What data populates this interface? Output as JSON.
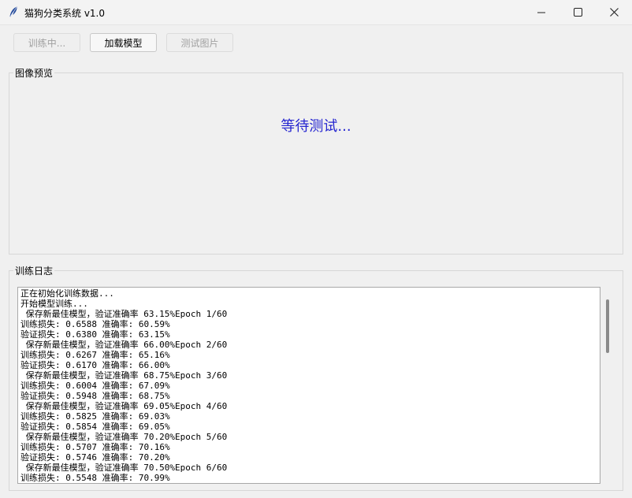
{
  "window": {
    "title": "猫狗分类系统 v1.0",
    "icons": {
      "app": "feather-icon",
      "minimize": "minimize-icon",
      "maximize": "maximize-icon",
      "close": "close-icon"
    }
  },
  "toolbar": {
    "train_label": "训练中...",
    "load_label": "加载模型",
    "test_label": "测试图片"
  },
  "preview": {
    "section_label": "图像预览",
    "status_text": "等待测试...",
    "status_color": "#2525d0"
  },
  "log": {
    "section_label": "训练日志",
    "lines": [
      "正在初始化训练数据...",
      "开始模型训练...",
      " 保存新最佳模型，验证准确率 63.15%Epoch 1/60",
      "训练损失: 0.6588 准确率: 60.59%",
      "验证损失: 0.6380 准确率: 63.15%",
      " 保存新最佳模型，验证准确率 66.00%Epoch 2/60",
      "训练损失: 0.6267 准确率: 65.16%",
      "验证损失: 0.6170 准确率: 66.00%",
      " 保存新最佳模型，验证准确率 68.75%Epoch 3/60",
      "训练损失: 0.6004 准确率: 67.09%",
      "验证损失: 0.5948 准确率: 68.75%",
      " 保存新最佳模型，验证准确率 69.05%Epoch 4/60",
      "训练损失: 0.5825 准确率: 69.03%",
      "验证损失: 0.5854 准确率: 69.05%",
      " 保存新最佳模型，验证准确率 70.20%Epoch 5/60",
      "训练损失: 0.5707 准确率: 70.16%",
      "验证损失: 0.5746 准确率: 70.20%",
      " 保存新最佳模型，验证准确率 70.50%Epoch 6/60",
      "训练损失: 0.5548 准确率: 70.99%"
    ]
  }
}
